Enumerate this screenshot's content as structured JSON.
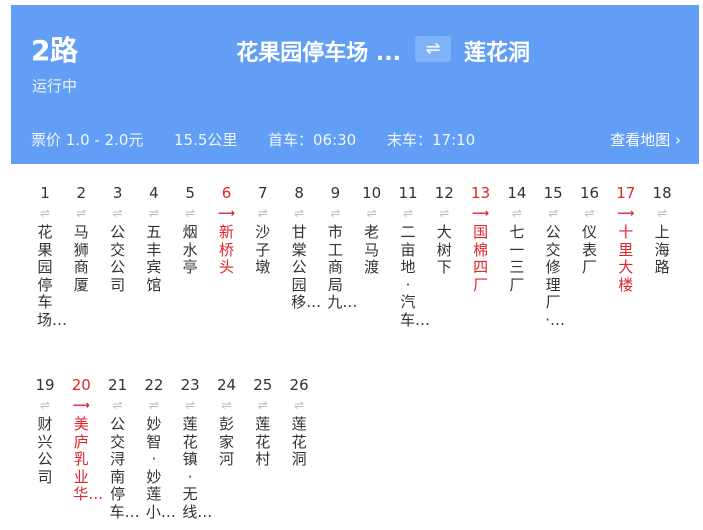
{
  "route": {
    "number": "2路",
    "status": "运行中",
    "from": "花果园停车场 ...",
    "to": "莲花洞",
    "swap_icon": "⇌"
  },
  "info": {
    "fare": "票价 1.0 - 2.0元",
    "distance": "15.5公里",
    "first_bus": "首车：06:30",
    "last_bus": "末车：17:10",
    "map_link": "查看地图 ›"
  },
  "colors": {
    "header": "#629ef6",
    "highlight": "#e0242b",
    "text": "#333333",
    "arrow": "#bbbbbb"
  },
  "stops": [
    {
      "num": "1",
      "arrow": "⇌",
      "name": "花果园停车场…",
      "hot": false
    },
    {
      "num": "2",
      "arrow": "⇌",
      "name": "马狮商厦",
      "hot": false
    },
    {
      "num": "3",
      "arrow": "⇌",
      "name": "公交公司",
      "hot": false
    },
    {
      "num": "4",
      "arrow": "⇌",
      "name": "五丰宾馆",
      "hot": false
    },
    {
      "num": "5",
      "arrow": "⇌",
      "name": "烟水亭",
      "hot": false
    },
    {
      "num": "6",
      "arrow": "⟶",
      "name": "新桥头",
      "hot": true
    },
    {
      "num": "7",
      "arrow": "⇌",
      "name": "沙子墩",
      "hot": false
    },
    {
      "num": "8",
      "arrow": "⇌",
      "name": "甘棠公园移…",
      "hot": false
    },
    {
      "num": "9",
      "arrow": "⇌",
      "name": "市工商局九…",
      "hot": false
    },
    {
      "num": "10",
      "arrow": "⇌",
      "name": "老马渡",
      "hot": false
    },
    {
      "num": "11",
      "arrow": "⇌",
      "name": "二亩地·汽车…",
      "hot": false
    },
    {
      "num": "12",
      "arrow": "⇌",
      "name": "大树下",
      "hot": false
    },
    {
      "num": "13",
      "arrow": "⟶",
      "name": "国棉四厂",
      "hot": true
    },
    {
      "num": "14",
      "arrow": "⇌",
      "name": "七一三厂",
      "hot": false
    },
    {
      "num": "15",
      "arrow": "⇌",
      "name": "公交修理厂·…",
      "hot": false
    },
    {
      "num": "16",
      "arrow": "⇌",
      "name": "仪表厂",
      "hot": false
    },
    {
      "num": "17",
      "arrow": "⟶",
      "name": "十里大楼",
      "hot": true
    },
    {
      "num": "18",
      "arrow": "⇌",
      "name": "上海路",
      "hot": false
    },
    {
      "num": "19",
      "arrow": "⇌",
      "name": "财兴公司",
      "hot": false
    },
    {
      "num": "20",
      "arrow": "⟶",
      "name": "美庐乳业华…",
      "hot": true
    },
    {
      "num": "21",
      "arrow": "⇌",
      "name": "公交浔南停车…",
      "hot": false
    },
    {
      "num": "22",
      "arrow": "⇌",
      "name": "妙智·妙莲小…",
      "hot": false
    },
    {
      "num": "23",
      "arrow": "⇌",
      "name": "莲花镇·无线…",
      "hot": false
    },
    {
      "num": "24",
      "arrow": "⇌",
      "name": "彭家河",
      "hot": false
    },
    {
      "num": "25",
      "arrow": "⇌",
      "name": "莲花村",
      "hot": false
    },
    {
      "num": "26",
      "arrow": "⇌",
      "name": "莲花洞",
      "hot": false
    }
  ]
}
